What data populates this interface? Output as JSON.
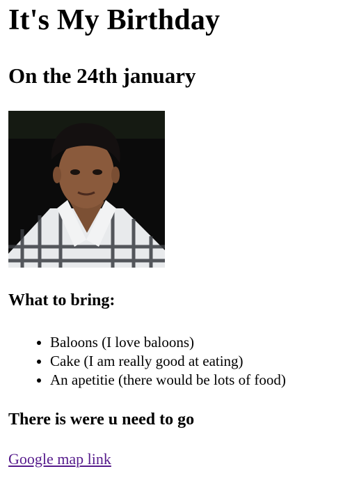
{
  "title": "It's My Birthday",
  "subtitle": "On the 24th january",
  "photo": {
    "alt": "Birthday boy portrait",
    "colors": {
      "background": "#0b0b0b",
      "skin": "#8a5a3c",
      "hair": "#141010",
      "shirt_light": "#e8eaec",
      "shirt_dark": "#3a3d42"
    }
  },
  "bring": {
    "heading": "What to bring:",
    "items": [
      "Baloons (I love baloons)",
      "Cake (I am really good at eating)",
      "An apetitie (there would be lots of food)"
    ]
  },
  "location": {
    "heading": "There is were u need to go",
    "link_text": "Google map link",
    "link_color": "#551a8b"
  }
}
